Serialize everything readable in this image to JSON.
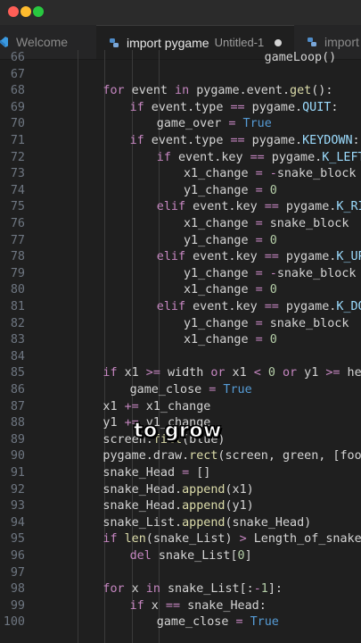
{
  "window": {
    "controls": [
      {
        "name": "close",
        "color": "#ff5f57"
      },
      {
        "name": "minimize",
        "color": "#febc2e"
      },
      {
        "name": "maximize",
        "color": "#28c840"
      }
    ]
  },
  "tabs": [
    {
      "label": "Welcome",
      "subtitle": "",
      "icon": "vscode-icon",
      "active": false
    },
    {
      "label": "import pygame",
      "subtitle": "Untitled-1",
      "icon": "python-icon",
      "active": true,
      "modified": true
    },
    {
      "label": "import",
      "subtitle": "",
      "icon": "python-icon",
      "active": false
    }
  ],
  "caption": "to grow",
  "lines": [
    {
      "n": "66",
      "indent": 8,
      "t": [
        [
          "ob",
          "gameLoop()"
        ]
      ]
    },
    {
      "n": "67",
      "indent": 0,
      "t": []
    },
    {
      "n": "68",
      "indent": 2,
      "t": [
        [
          "kw",
          "for "
        ],
        [
          "ob",
          "event "
        ],
        [
          "kw",
          "in "
        ],
        [
          "ob",
          "pygame.event."
        ],
        [
          "fn",
          "get"
        ],
        [
          "ob",
          "():"
        ]
      ]
    },
    {
      "n": "69",
      "indent": 3,
      "t": [
        [
          "kw",
          "if "
        ],
        [
          "ob",
          "event.type "
        ],
        [
          "kw",
          "== "
        ],
        [
          "ob",
          "pygame."
        ],
        [
          "cn",
          "QUIT"
        ],
        [
          "ob",
          ":"
        ]
      ]
    },
    {
      "n": "70",
      "indent": 4,
      "t": [
        [
          "ob",
          "game_over "
        ],
        [
          "kw",
          "= "
        ],
        [
          "kc",
          "True"
        ]
      ]
    },
    {
      "n": "71",
      "indent": 3,
      "t": [
        [
          "kw",
          "if "
        ],
        [
          "ob",
          "event.type "
        ],
        [
          "kw",
          "== "
        ],
        [
          "ob",
          "pygame."
        ],
        [
          "cn",
          "KEYDOWN"
        ],
        [
          "ob",
          ":"
        ]
      ]
    },
    {
      "n": "72",
      "indent": 4,
      "t": [
        [
          "kw",
          "if "
        ],
        [
          "ob",
          "event.key "
        ],
        [
          "kw",
          "== "
        ],
        [
          "ob",
          "pygame."
        ],
        [
          "cn",
          "K_LEFT"
        ],
        [
          "ob",
          ":"
        ]
      ]
    },
    {
      "n": "73",
      "indent": 5,
      "t": [
        [
          "ob",
          "x1_change "
        ],
        [
          "kw",
          "= -"
        ],
        [
          "ob",
          "snake_block"
        ]
      ]
    },
    {
      "n": "74",
      "indent": 5,
      "t": [
        [
          "ob",
          "y1_change "
        ],
        [
          "kw",
          "= "
        ],
        [
          "num",
          "0"
        ]
      ]
    },
    {
      "n": "75",
      "indent": 4,
      "t": [
        [
          "kw",
          "elif "
        ],
        [
          "ob",
          "event.key "
        ],
        [
          "kw",
          "== "
        ],
        [
          "ob",
          "pygame."
        ],
        [
          "cn",
          "K_RIGHT"
        ],
        [
          "ob",
          ":"
        ]
      ]
    },
    {
      "n": "76",
      "indent": 5,
      "t": [
        [
          "ob",
          "x1_change "
        ],
        [
          "kw",
          "= "
        ],
        [
          "ob",
          "snake_block"
        ]
      ]
    },
    {
      "n": "77",
      "indent": 5,
      "t": [
        [
          "ob",
          "y1_change "
        ],
        [
          "kw",
          "= "
        ],
        [
          "num",
          "0"
        ]
      ]
    },
    {
      "n": "78",
      "indent": 4,
      "t": [
        [
          "kw",
          "elif "
        ],
        [
          "ob",
          "event.key "
        ],
        [
          "kw",
          "== "
        ],
        [
          "ob",
          "pygame."
        ],
        [
          "cn",
          "K_UP"
        ],
        [
          "ob",
          ":"
        ]
      ]
    },
    {
      "n": "79",
      "indent": 5,
      "t": [
        [
          "ob",
          "y1_change "
        ],
        [
          "kw",
          "= -"
        ],
        [
          "ob",
          "snake_block"
        ]
      ]
    },
    {
      "n": "80",
      "indent": 5,
      "t": [
        [
          "ob",
          "x1_change "
        ],
        [
          "kw",
          "= "
        ],
        [
          "num",
          "0"
        ]
      ]
    },
    {
      "n": "81",
      "indent": 4,
      "t": [
        [
          "kw",
          "elif "
        ],
        [
          "ob",
          "event.key "
        ],
        [
          "kw",
          "== "
        ],
        [
          "ob",
          "pygame."
        ],
        [
          "cn",
          "K_DOWN"
        ],
        [
          "ob",
          ":"
        ]
      ]
    },
    {
      "n": "82",
      "indent": 5,
      "t": [
        [
          "ob",
          "y1_change "
        ],
        [
          "kw",
          "= "
        ],
        [
          "ob",
          "snake_block"
        ]
      ]
    },
    {
      "n": "83",
      "indent": 5,
      "t": [
        [
          "ob",
          "x1_change "
        ],
        [
          "kw",
          "= "
        ],
        [
          "num",
          "0"
        ]
      ]
    },
    {
      "n": "84",
      "indent": 0,
      "t": []
    },
    {
      "n": "85",
      "indent": 2,
      "t": [
        [
          "kw",
          "if "
        ],
        [
          "ob",
          "x1 "
        ],
        [
          "kw",
          ">= "
        ],
        [
          "ob",
          "width "
        ],
        [
          "kw",
          "or "
        ],
        [
          "ob",
          "x1 "
        ],
        [
          "kw",
          "< "
        ],
        [
          "num",
          "0 "
        ],
        [
          "kw",
          "or "
        ],
        [
          "ob",
          "y1 "
        ],
        [
          "kw",
          ">= "
        ],
        [
          "ob",
          "height"
        ]
      ]
    },
    {
      "n": "86",
      "indent": 3,
      "t": [
        [
          "ob",
          "game_close "
        ],
        [
          "kw",
          "= "
        ],
        [
          "kc",
          "True"
        ]
      ]
    },
    {
      "n": "87",
      "indent": 2,
      "t": [
        [
          "ob",
          "x1 "
        ],
        [
          "kw",
          "+= "
        ],
        [
          "ob",
          "x1_change"
        ]
      ]
    },
    {
      "n": "88",
      "indent": 2,
      "t": [
        [
          "ob",
          "y1 "
        ],
        [
          "kw",
          "+= "
        ],
        [
          "ob",
          "y1_change"
        ]
      ]
    },
    {
      "n": "89",
      "indent": 2,
      "t": [
        [
          "ob",
          "screen."
        ],
        [
          "fn",
          "fill"
        ],
        [
          "ob",
          "(blue)"
        ]
      ]
    },
    {
      "n": "90",
      "indent": 2,
      "t": [
        [
          "ob",
          "pygame.draw."
        ],
        [
          "fn",
          "rect"
        ],
        [
          "ob",
          "(screen, green, [foodx, foody"
        ]
      ]
    },
    {
      "n": "91",
      "indent": 2,
      "t": [
        [
          "ob",
          "snake_Head "
        ],
        [
          "kw",
          "= "
        ],
        [
          "ob",
          "[]"
        ]
      ]
    },
    {
      "n": "92",
      "indent": 2,
      "t": [
        [
          "ob",
          "snake_Head."
        ],
        [
          "fn",
          "append"
        ],
        [
          "ob",
          "(x1)"
        ]
      ]
    },
    {
      "n": "93",
      "indent": 2,
      "t": [
        [
          "ob",
          "snake_Head."
        ],
        [
          "fn",
          "append"
        ],
        [
          "ob",
          "(y1)"
        ]
      ]
    },
    {
      "n": "94",
      "indent": 2,
      "t": [
        [
          "ob",
          "snake_List."
        ],
        [
          "fn",
          "append"
        ],
        [
          "ob",
          "(snake_Head)"
        ]
      ]
    },
    {
      "n": "95",
      "indent": 2,
      "t": [
        [
          "kw",
          "if "
        ],
        [
          "fn",
          "len"
        ],
        [
          "ob",
          "(snake_List) "
        ],
        [
          "kw",
          "> "
        ],
        [
          "ob",
          "Length_of_snake:"
        ]
      ]
    },
    {
      "n": "96",
      "indent": 3,
      "t": [
        [
          "kw",
          "del "
        ],
        [
          "ob",
          "snake_List["
        ],
        [
          "num",
          "0"
        ],
        [
          "ob",
          "]"
        ]
      ]
    },
    {
      "n": "97",
      "indent": 0,
      "t": []
    },
    {
      "n": "98",
      "indent": 2,
      "t": [
        [
          "kw",
          "for "
        ],
        [
          "ob",
          "x "
        ],
        [
          "kw",
          "in "
        ],
        [
          "ob",
          "snake_List[:"
        ],
        [
          "kw",
          "-"
        ],
        [
          "num",
          "1"
        ],
        [
          "ob",
          "]:"
        ]
      ]
    },
    {
      "n": "99",
      "indent": 3,
      "t": [
        [
          "kw",
          "if "
        ],
        [
          "ob",
          "x "
        ],
        [
          "kw",
          "== "
        ],
        [
          "ob",
          "snake_Head:"
        ]
      ]
    },
    {
      "n": "100",
      "indent": 4,
      "t": [
        [
          "ob",
          "game_close "
        ],
        [
          "kw",
          "= "
        ],
        [
          "kc",
          "True"
        ]
      ]
    }
  ]
}
